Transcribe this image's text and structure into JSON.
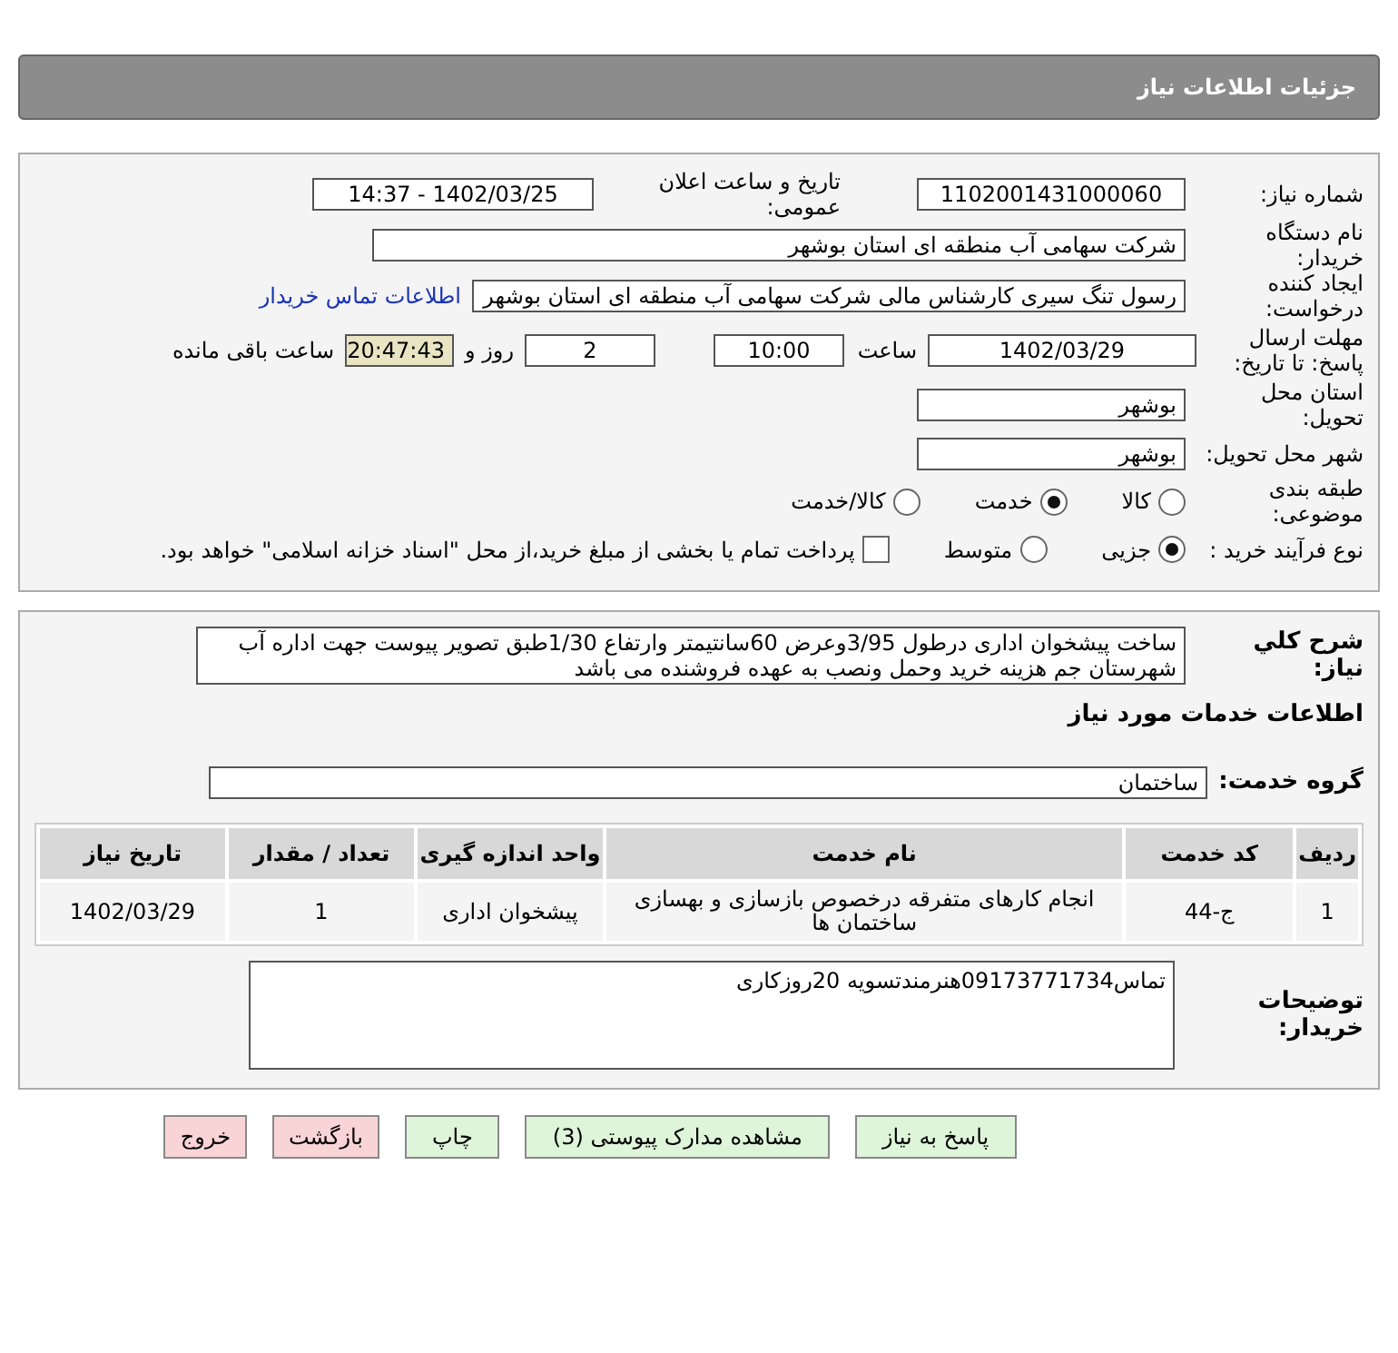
{
  "header": {
    "title": "جزئیات اطلاعات نیاز"
  },
  "details": {
    "need_number": {
      "label": "شماره نیاز:",
      "value": "1102001431000060"
    },
    "announce": {
      "label": "تاریخ و ساعت اعلان عمومی:",
      "value": "1402/03/25 - 14:37"
    },
    "buyer": {
      "label": "نام دستگاه خریدار:",
      "value": "شرکت سهامی آب منطقه ای استان بوشهر"
    },
    "creator": {
      "label": "ایجاد کننده درخواست:",
      "value": "رسول تنگ سیری کارشناس مالی شرکت سهامی آب منطقه ای استان بوشهر",
      "link": "اطلاعات تماس خریدار"
    },
    "deadline": {
      "label": "مهلت ارسال پاسخ: تا تاریخ:",
      "date": "1402/03/29",
      "time_label": "ساعت",
      "time": "10:00",
      "days": "2",
      "days_label": "روز و",
      "remaining": "20:47:43",
      "remaining_label": "ساعت باقی مانده"
    },
    "province": {
      "label": "استان محل تحویل:",
      "value": "بوشهر"
    },
    "city": {
      "label": "شهر محل تحویل:",
      "value": "بوشهر"
    },
    "category": {
      "label": "طبقه بندی موضوعی:",
      "options": [
        {
          "label": "کالا",
          "selected": false
        },
        {
          "label": "خدمت",
          "selected": true
        },
        {
          "label": "کالا/خدمت",
          "selected": false
        }
      ]
    },
    "process": {
      "label": "نوع فرآیند خرید :",
      "options": [
        {
          "label": "جزیی",
          "selected": true
        },
        {
          "label": "متوسط",
          "selected": false
        }
      ],
      "payment": {
        "checked": false,
        "label": "پرداخت تمام یا بخشی از مبلغ خرید،از محل \"اسناد خزانه اسلامی\" خواهد بود."
      }
    }
  },
  "need": {
    "summary": {
      "label": "شرح کلي نياز:",
      "value": "ساخت پیشخوان اداری درطول 3/95وعرض 60سانتیمتر وارتفاع 1/30طبق تصویر پیوست جهت اداره آب شهرستان جم هزینه خرید وحمل ونصب به عهده فروشنده می باشد"
    },
    "services_heading": "اطلاعات خدمات مورد نیاز",
    "group": {
      "label": "گروه خدمت:",
      "value": "ساختمان"
    },
    "table": {
      "columns": [
        "ردیف",
        "کد خدمت",
        "نام خدمت",
        "واحد اندازه گیری",
        "تعداد / مقدار",
        "تاریخ نیاز"
      ],
      "rows": [
        [
          "1",
          "ج-44",
          "انجام کارهای متفرقه درخصوص بازسازی و بهسازی ساختمان ها",
          "پیشخوان اداری",
          "1",
          "1402/03/29"
        ]
      ]
    },
    "notes": {
      "label": "توضیحات خریدار:",
      "value": "تماس09173771734هنرمندتسویه 20روزکاری"
    }
  },
  "buttons": [
    {
      "label": "پاسخ به نیاز",
      "kind": "normal"
    },
    {
      "label": "مشاهده مدارک پیوستی (3)",
      "kind": "normal"
    },
    {
      "label": "چاپ",
      "kind": "normal"
    },
    {
      "label": "بازگشت",
      "kind": "danger"
    },
    {
      "label": "خروج",
      "kind": "danger"
    }
  ]
}
